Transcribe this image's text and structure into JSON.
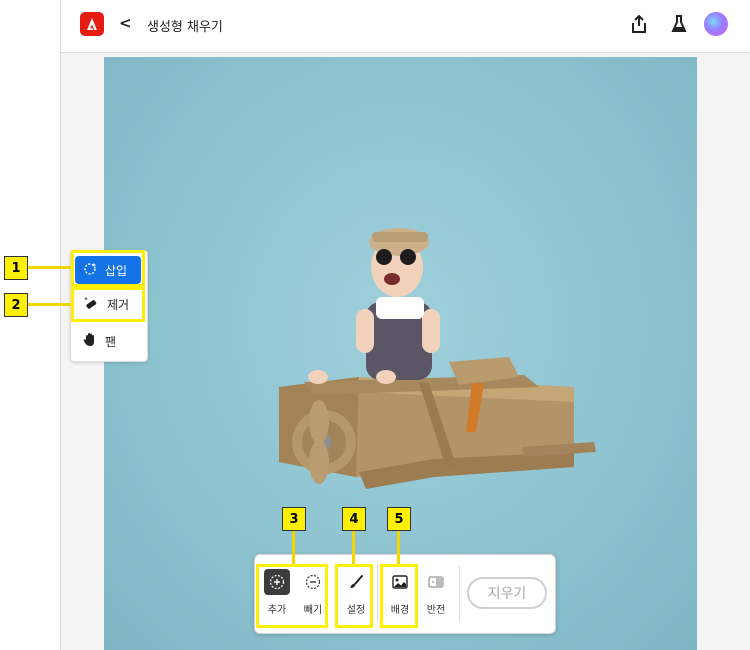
{
  "topbar": {
    "title": "생성형 채우기",
    "back_glyph": "<"
  },
  "tools": [
    {
      "label": "삽입",
      "icon": "sparkle-lasso-icon",
      "active": true
    },
    {
      "label": "제거",
      "icon": "eraser-sparkle-icon",
      "active": false
    },
    {
      "label": "팬",
      "icon": "hand-icon",
      "active": false
    }
  ],
  "bottom": {
    "add_label": "추가",
    "subtract_label": "빼기",
    "settings_label": "설정",
    "background_label": "배경",
    "invert_label": "반전",
    "clear_label": "지우기"
  },
  "callouts": {
    "c1": "1",
    "c2": "2",
    "c3": "3",
    "c4": "4",
    "c5": "5"
  },
  "colors": {
    "accent": "#1473e6",
    "highlight": "#ffef00",
    "brand": "#e41c12",
    "photo_bg": "#8ec3d0"
  }
}
